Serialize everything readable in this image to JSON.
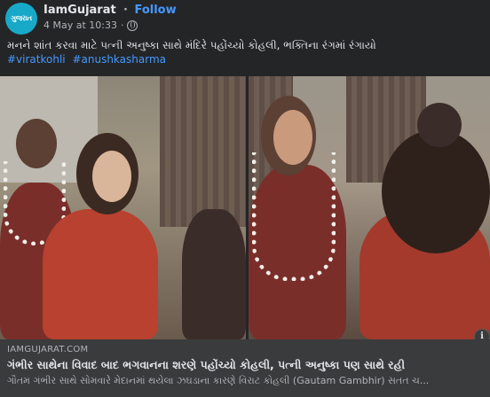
{
  "header": {
    "avatar_text": "ગુજરાત",
    "page_name": "IamGujarat",
    "separator": "·",
    "follow_label": "Follow",
    "date": "4 May at 10:33",
    "meta_dot": "·",
    "privacy_icon": "globe-icon"
  },
  "post": {
    "caption": "મનને શાંત કરવા માટે પત્ની અનુષ્કા સાથે મંદિરે પહોંચ્યો કોહલી, ભક્તિના રંગમાં રંગાયો",
    "hashtags": [
      "#viratkohli",
      "#anushkasharma"
    ]
  },
  "link_preview": {
    "domain": "IAMGUJARAT.COM",
    "title": "ગંભીર સાથેના વિવાદ બાદ ભગવાનના શરણે પહોંચ્યો કોહલી, પત્ની અનુષ્કા પણ સાથે રહી",
    "description": "ગૌતમ ગંભીર સાથે સોમવારે મેદાનમાં થયેલા ઝઘડાના કારણે વિરાટ કોહલી (Gautam Gambhir) સતત ચ...",
    "info_icon": "info-icon",
    "info_glyph": "i"
  },
  "colors": {
    "background": "#242526",
    "link": "#4599ff",
    "text": "#e4e6eb",
    "muted": "#b0b3b8"
  }
}
